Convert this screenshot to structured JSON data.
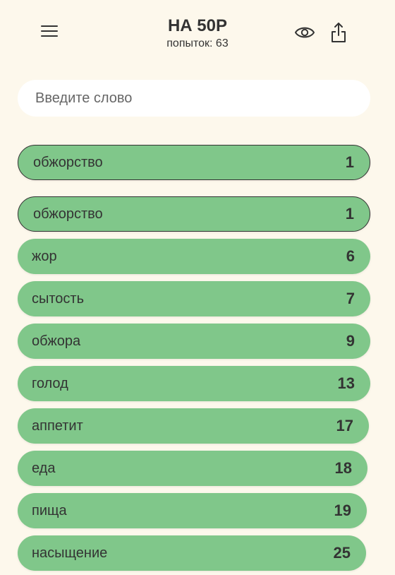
{
  "header": {
    "title": "НА 50Р",
    "attempts": "попыток: 63",
    "menu_icon": "menu-icon",
    "eye_icon": "eye-icon",
    "share_icon": "share-icon"
  },
  "search": {
    "placeholder": "Введите слово",
    "value": ""
  },
  "last_guess": {
    "word": "обжорство",
    "rank": "1"
  },
  "guesses": [
    {
      "word": "обжорство",
      "rank": "1"
    },
    {
      "word": "жор",
      "rank": "6"
    },
    {
      "word": "сытость",
      "rank": "7"
    },
    {
      "word": "обжора",
      "rank": "9"
    },
    {
      "word": "голод",
      "rank": "13"
    },
    {
      "word": "аппетит",
      "rank": "17"
    },
    {
      "word": "еда",
      "rank": "18"
    },
    {
      "word": "пища",
      "rank": "19"
    },
    {
      "word": "насыщение",
      "rank": "25"
    }
  ],
  "colors": {
    "background": "#fdf8ec",
    "row_green": "#80c78a",
    "text": "#333333"
  }
}
